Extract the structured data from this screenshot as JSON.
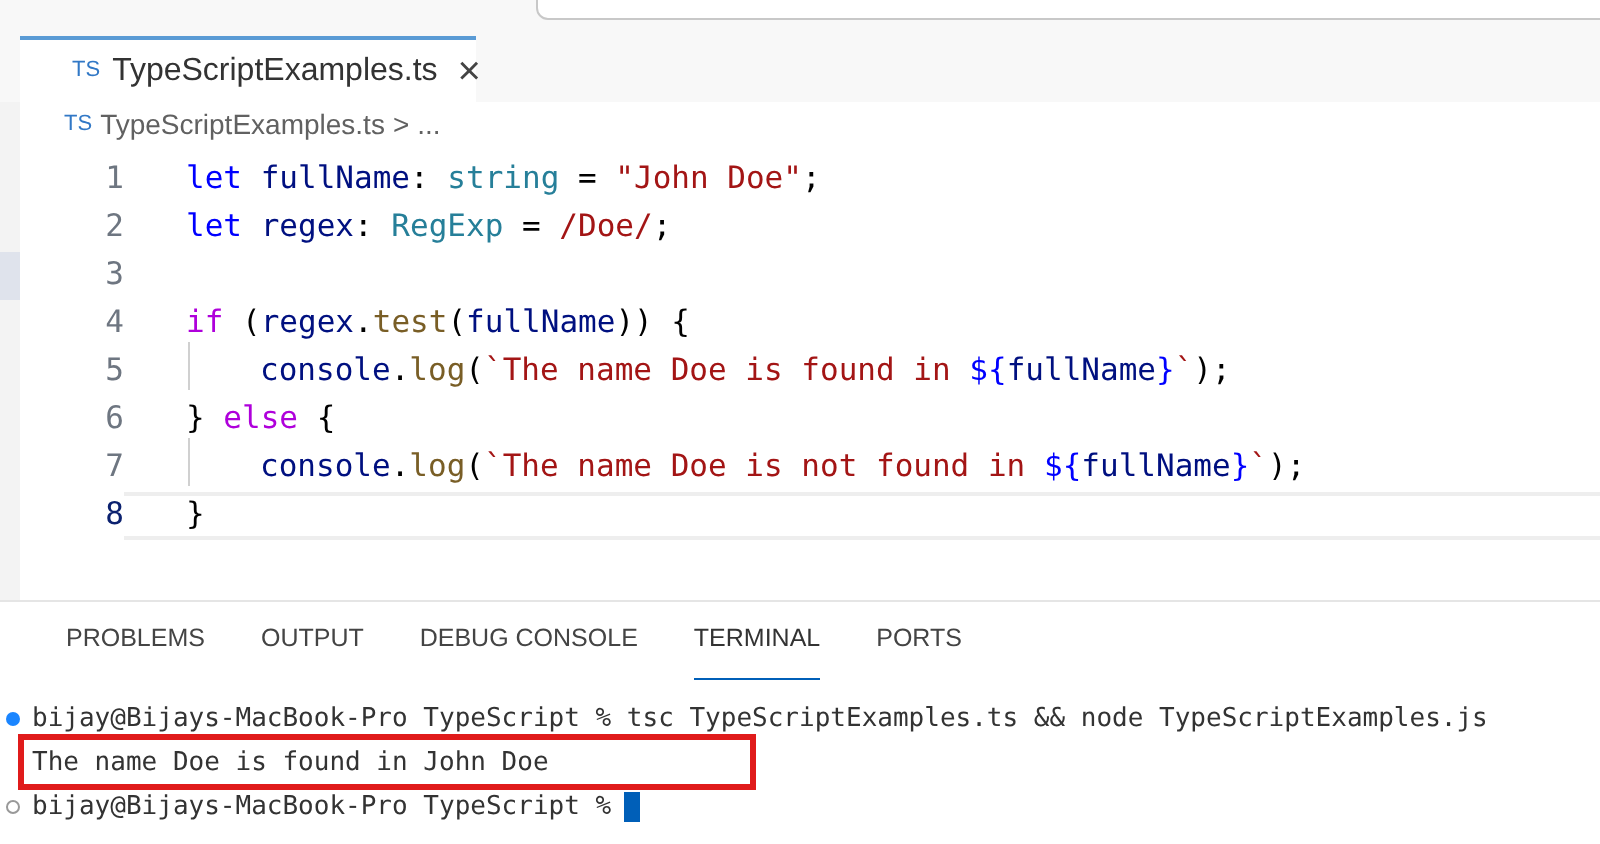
{
  "editor_tab": {
    "icon": "TS",
    "label": "TypeScriptExamples.ts",
    "close": "×",
    "selected": true
  },
  "breadcrumb": {
    "icon": "TS",
    "file": "TypeScriptExamples.ts",
    "separator": ">",
    "more": "..."
  },
  "code_lines": [
    {
      "number": "1",
      "current": false,
      "guide": false,
      "tokens": [
        {
          "kind": "keyword",
          "text": "let "
        },
        {
          "kind": "variable",
          "text": "fullName"
        },
        {
          "kind": "plain",
          "text": ": "
        },
        {
          "kind": "type",
          "text": "string"
        },
        {
          "kind": "plain",
          "text": " = "
        },
        {
          "kind": "string",
          "text": "\"John Doe\""
        },
        {
          "kind": "plain",
          "text": ";"
        }
      ]
    },
    {
      "number": "2",
      "current": false,
      "guide": false,
      "tokens": [
        {
          "kind": "keyword",
          "text": "let "
        },
        {
          "kind": "variable",
          "text": "regex"
        },
        {
          "kind": "plain",
          "text": ": "
        },
        {
          "kind": "type",
          "text": "RegExp"
        },
        {
          "kind": "plain",
          "text": " = "
        },
        {
          "kind": "string",
          "text": "/Doe/"
        },
        {
          "kind": "plain",
          "text": ";"
        }
      ]
    },
    {
      "number": "3",
      "current": false,
      "guide": false
    },
    {
      "number": "4",
      "current": false,
      "guide": false,
      "tokens": [
        {
          "kind": "control",
          "text": "if"
        },
        {
          "kind": "plain",
          "text": " ("
        },
        {
          "kind": "variable",
          "text": "regex"
        },
        {
          "kind": "plain",
          "text": "."
        },
        {
          "kind": "function",
          "text": "test"
        },
        {
          "kind": "plain",
          "text": "("
        },
        {
          "kind": "variable",
          "text": "fullName"
        },
        {
          "kind": "plain",
          "text": ")) {"
        }
      ]
    },
    {
      "number": "5",
      "current": false,
      "guide": true,
      "tokens": [
        {
          "kind": "variable",
          "text": "console"
        },
        {
          "kind": "plain",
          "text": "."
        },
        {
          "kind": "function",
          "text": "log"
        },
        {
          "kind": "plain",
          "text": "("
        },
        {
          "kind": "string",
          "text": "`The name Doe is found in "
        },
        {
          "kind": "keyword",
          "text": "${"
        },
        {
          "kind": "variable",
          "text": "fullName"
        },
        {
          "kind": "keyword",
          "text": "}"
        },
        {
          "kind": "string",
          "text": "`"
        },
        {
          "kind": "plain",
          "text": ");"
        }
      ]
    },
    {
      "number": "6",
      "current": false,
      "guide": false,
      "tokens": [
        {
          "kind": "plain",
          "text": "} "
        },
        {
          "kind": "control",
          "text": "else"
        },
        {
          "kind": "plain",
          "text": " {"
        }
      ]
    },
    {
      "number": "7",
      "current": false,
      "guide": true,
      "tokens": [
        {
          "kind": "variable",
          "text": "console"
        },
        {
          "kind": "plain",
          "text": "."
        },
        {
          "kind": "function",
          "text": "log"
        },
        {
          "kind": "plain",
          "text": "("
        },
        {
          "kind": "string",
          "text": "`The name Doe is not found in "
        },
        {
          "kind": "keyword",
          "text": "${"
        },
        {
          "kind": "variable",
          "text": "fullName"
        },
        {
          "kind": "keyword",
          "text": "}"
        },
        {
          "kind": "string",
          "text": "`"
        },
        {
          "kind": "plain",
          "text": ");"
        }
      ]
    },
    {
      "number": "8",
      "current": true,
      "guide": false,
      "tokens": [
        {
          "kind": "plain",
          "text": "}"
        }
      ]
    }
  ],
  "panel_tabs": [
    {
      "label": "PROBLEMS",
      "selected": false
    },
    {
      "label": "OUTPUT",
      "selected": false
    },
    {
      "label": "DEBUG CONSOLE",
      "selected": false
    },
    {
      "label": "TERMINAL",
      "selected": true
    },
    {
      "label": "PORTS",
      "selected": false
    }
  ],
  "terminal_lines": [
    {
      "kind": "prompt",
      "done": true,
      "text": "bijay@Bijays-MacBook-Pro TypeScript % tsc TypeScriptExamples.ts && node TypeScriptExamples.js"
    },
    {
      "kind": "output",
      "text": "The name Doe is found in John Doe"
    },
    {
      "kind": "prompt",
      "done": false,
      "text": "bijay@Bijays-MacBook-Pro TypeScript %",
      "cursor": true
    }
  ]
}
